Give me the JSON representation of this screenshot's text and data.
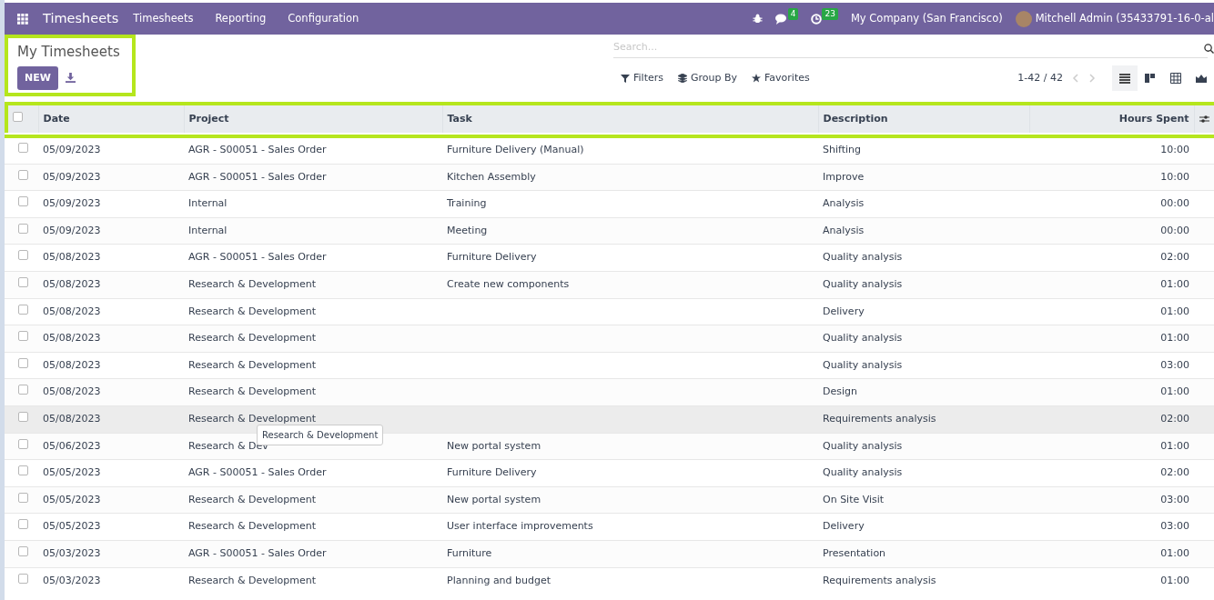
{
  "navbar": {
    "app": "Timesheets",
    "menu": [
      "Timesheets",
      "Reporting",
      "Configuration"
    ],
    "messages_count": "4",
    "activities_count": "23",
    "company": "My Company (San Francisco)",
    "user": "Mitchell Admin (35433791-16-0-al"
  },
  "control_panel": {
    "title": "My Timesheets",
    "new_button": "NEW",
    "search": {
      "placeholder": "Search..."
    },
    "filters": [
      "Filters",
      "Group By",
      "Favorites"
    ],
    "pager": "1-42 / 42",
    "views": [
      {
        "kind": "list",
        "selected": true
      },
      {
        "kind": "kanban",
        "selected": false
      },
      {
        "kind": "pivot",
        "selected": false
      },
      {
        "kind": "graph",
        "selected": false
      }
    ]
  },
  "table": {
    "select_all_checked": false,
    "columns": [
      "Date",
      "Project",
      "Task",
      "Description",
      "Hours Spent"
    ],
    "rows": [
      {
        "date": "05/09/2023",
        "project": "AGR - S00051 - Sales Order",
        "task": "Furniture Delivery (Manual)",
        "description": "Shifting",
        "hours": "10:00",
        "hovered": false,
        "checked": false
      },
      {
        "date": "05/09/2023",
        "project": "AGR - S00051 - Sales Order",
        "task": "Kitchen Assembly",
        "description": "Improve",
        "hours": "10:00",
        "hovered": false,
        "checked": false
      },
      {
        "date": "05/09/2023",
        "project": "Internal",
        "task": "Training",
        "description": "Analysis",
        "hours": "00:00",
        "hovered": false,
        "checked": false
      },
      {
        "date": "05/09/2023",
        "project": "Internal",
        "task": "Meeting",
        "description": "Analysis",
        "hours": "00:00",
        "hovered": false,
        "checked": false
      },
      {
        "date": "05/08/2023",
        "project": "AGR - S00051 - Sales Order",
        "task": "Furniture Delivery",
        "description": "Quality analysis",
        "hours": "02:00",
        "hovered": false,
        "checked": false
      },
      {
        "date": "05/08/2023",
        "project": "Research & Development",
        "task": "Create new components",
        "description": "Quality analysis",
        "hours": "01:00",
        "hovered": false,
        "checked": false
      },
      {
        "date": "05/08/2023",
        "project": "Research & Development",
        "description": "Delivery",
        "hours": "01:00",
        "hovered": false,
        "checked": false
      },
      {
        "date": "05/08/2023",
        "project": "Research & Development",
        "description": "Quality analysis",
        "hours": "01:00",
        "hovered": false,
        "checked": false
      },
      {
        "date": "05/08/2023",
        "project": "Research & Development",
        "description": "Quality analysis",
        "hours": "03:00",
        "hovered": false,
        "checked": false
      },
      {
        "date": "05/08/2023",
        "project": "Research & Development",
        "description": "Design",
        "hours": "01:00",
        "hovered": false,
        "checked": false
      },
      {
        "date": "05/08/2023",
        "project": "Research & Development",
        "description": "Requirements analysis",
        "hours": "02:00",
        "hovered": true,
        "checked": false,
        "tooltip": "Research & Development"
      },
      {
        "date": "05/06/2023",
        "project": "Research & Dev",
        "task": "New portal system",
        "description": "Quality analysis",
        "hours": "01:00",
        "hovered": false,
        "checked": false
      },
      {
        "date": "05/05/2023",
        "project": "AGR - S00051 - Sales Order",
        "task": "Furniture Delivery",
        "description": "Quality analysis",
        "hours": "02:00",
        "hovered": false,
        "checked": false
      },
      {
        "date": "05/05/2023",
        "project": "Research & Development",
        "task": "New portal system",
        "description": "On Site Visit",
        "hours": "03:00",
        "hovered": false,
        "checked": false
      },
      {
        "date": "05/05/2023",
        "project": "Research & Development",
        "task": "User interface improvements",
        "description": "Delivery",
        "hours": "03:00",
        "hovered": false,
        "checked": false
      },
      {
        "date": "05/03/2023",
        "project": "AGR - S00051 - Sales Order",
        "task": "Furniture",
        "description": "Presentation",
        "hours": "01:00",
        "hovered": false,
        "checked": false
      },
      {
        "date": "05/03/2023",
        "project": "Research & Development",
        "task": "Planning and budget",
        "description": "Requirements analysis",
        "hours": "01:00",
        "hovered": false,
        "checked": false
      }
    ]
  }
}
